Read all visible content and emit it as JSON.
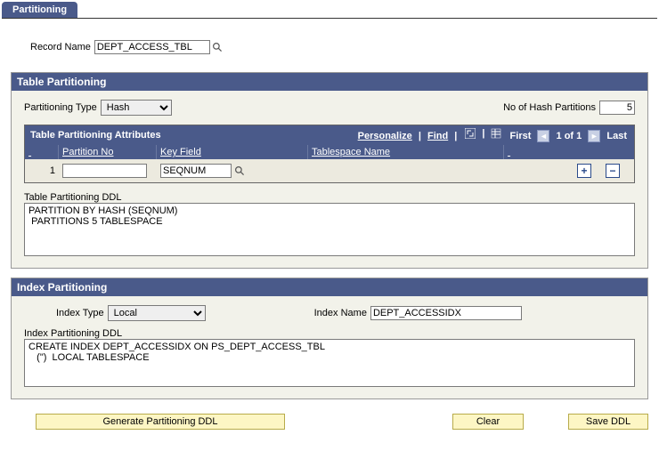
{
  "tab": {
    "label": "Partitioning"
  },
  "record": {
    "label": "Record Name",
    "value": "DEPT_ACCESS_TBL"
  },
  "tablePart": {
    "title": "Table Partitioning",
    "typeLabel": "Partitioning Type",
    "typeOptions": [
      "Hash"
    ],
    "typeValue": "Hash",
    "hashLabel": "No of Hash Partitions",
    "hashValue": "5",
    "gridTitle": "Table Partitioning Attributes",
    "gridLinks": {
      "personalize": "Personalize",
      "find": "Find"
    },
    "gridNav": {
      "first": "First",
      "range": "1 of 1",
      "last": "Last"
    },
    "headers": {
      "partitionNo": "Partition No",
      "keyField": "Key Field",
      "tablespace": "Tablespace Name"
    },
    "rows": [
      {
        "rownum": "1",
        "partitionNo": "",
        "keyField": "SEQNUM",
        "tablespace": ""
      }
    ],
    "ddlLabel": "Table Partitioning DDL",
    "ddl": "PARTITION BY HASH (SEQNUM)\n PARTITIONS 5 TABLESPACE"
  },
  "indexPart": {
    "title": "Index Partitioning",
    "typeLabel": "Index Type",
    "typeOptions": [
      "Local"
    ],
    "typeValue": "Local",
    "nameLabel": "Index Name",
    "nameValue": "DEPT_ACCESSIDX",
    "ddlLabel": "Index Partitioning DDL",
    "ddl": "CREATE INDEX DEPT_ACCESSIDX ON PS_DEPT_ACCESS_TBL\n   (\")  LOCAL TABLESPACE"
  },
  "buttons": {
    "generate": "Generate Partitioning DDL",
    "clear": "Clear",
    "save": "Save DDL"
  }
}
